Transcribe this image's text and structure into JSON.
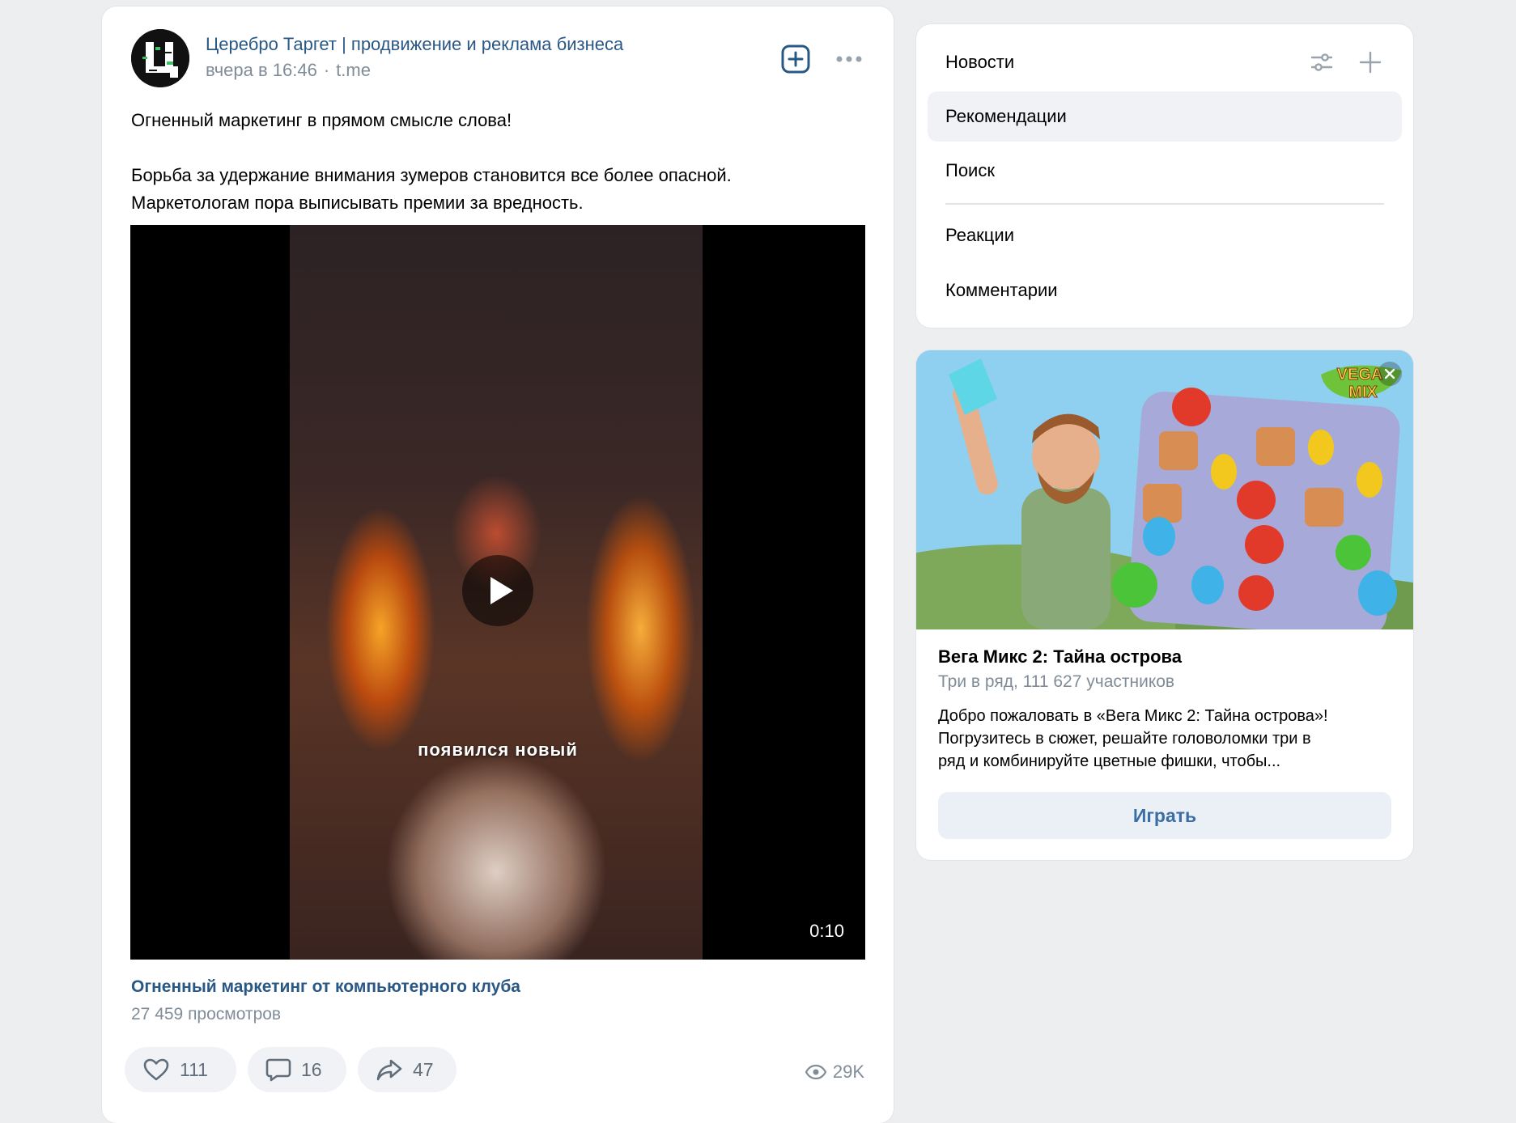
{
  "post": {
    "author": "Церебро Таргет | продвижение и реклама бизнеса",
    "time": "вчера в 16:46",
    "separator": "·",
    "source": "t.me",
    "text": {
      "line1": "Огненный маркетинг в прямом смысле слова!",
      "line2": "Борьба за удержание внимания зумеров становится все более опасной.",
      "line3": "Маркетологам пора выписывать премии за вредность."
    },
    "video": {
      "caption": "появился новый",
      "duration": "0:10",
      "title": "Огненный маркетинг от компьютерного клуба",
      "views": "27 459 просмотров"
    },
    "actions": {
      "likes": "111",
      "comments": "16",
      "shares": "47"
    },
    "views_total": "29K"
  },
  "menu": {
    "items": [
      {
        "label": "Новости"
      },
      {
        "label": "Рекомендации",
        "active": true
      },
      {
        "label": "Поиск"
      },
      {
        "label": "Реакции"
      },
      {
        "label": "Комментарии"
      }
    ]
  },
  "ad": {
    "logo_text": "VEGA MIX",
    "title": "Вега Микс 2: Тайна острова",
    "subtitle": "Три в ряд, 111 627 участников",
    "desc_line1": "Добро пожаловать в «Вега Микс 2: Тайна острова»!",
    "desc_line2": "Погрузитесь в сюжет, решайте головоломки три в",
    "desc_line3": "ряд и комбинируйте цветные фишки, чтобы...",
    "button": "Играть"
  },
  "colors": {
    "link": "#2a5885",
    "muted": "#818c99",
    "icon_accent": "#2a5885",
    "page_bg": "#edeef0"
  }
}
